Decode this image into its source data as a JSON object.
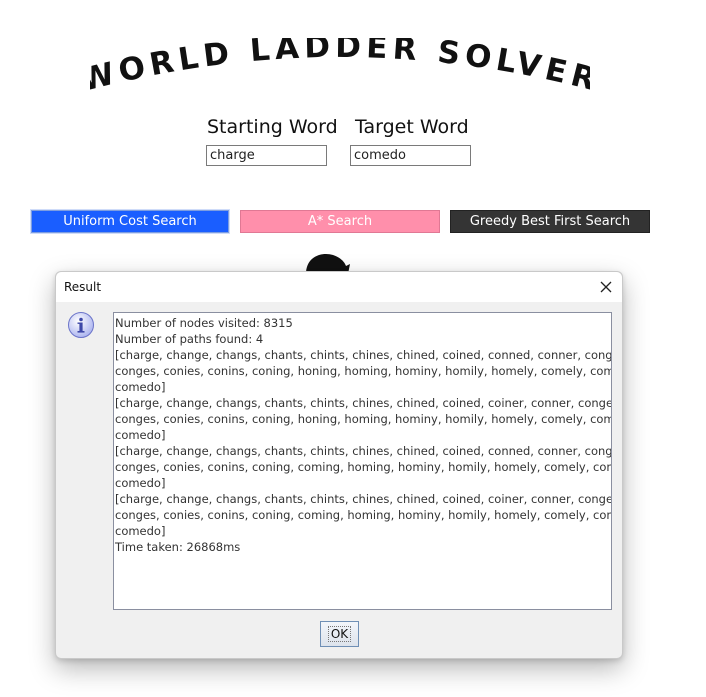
{
  "app": {
    "title": "WORLD LADDER SOLVER"
  },
  "form": {
    "start_label": "Starting Word",
    "start_value": "charge",
    "target_label": "Target Word",
    "target_value": "comedo"
  },
  "buttons": {
    "ucs": "Uniform Cost Search",
    "astar": "A* Search",
    "gbfs": "Greedy Best First Search"
  },
  "colors": {
    "ucs": "#1a5eff",
    "astar": "#ff8fab",
    "gbfs": "#343434"
  },
  "dialog": {
    "title": "Result",
    "icon": "info-icon",
    "close_icon": "close-icon",
    "lines": [
      "Number of nodes visited: 8315",
      "Number of paths found: 4",
      "[charge, change, changs, chants, chints, chines, chined, coined, conned, conner, conger,",
      "conges, conies, conins, coning, honing, homing, hominy, homily, homely, comely, comedy,",
      "comedo]",
      "[charge, change, changs, chants, chints, chines, chined, coined, coiner, conner, conger,",
      "conges, conies, conins, coning, honing, homing, hominy, homily, homely, comely, comedy,",
      "comedo]",
      "[charge, change, changs, chants, chints, chines, chined, coined, conned, conner, conger,",
      "conges, conies, conins, coning, coming, homing, hominy, homily, homely, comely, comedy,",
      "comedo]",
      "[charge, change, changs, chants, chints, chines, chined, coined, coiner, conner, conger,",
      "conges, conies, conins, coning, coming, homing, hominy, homily, homely, comely, comedy,",
      "comedo]",
      "Time taken: 26868ms"
    ],
    "ok_label": "OK"
  }
}
